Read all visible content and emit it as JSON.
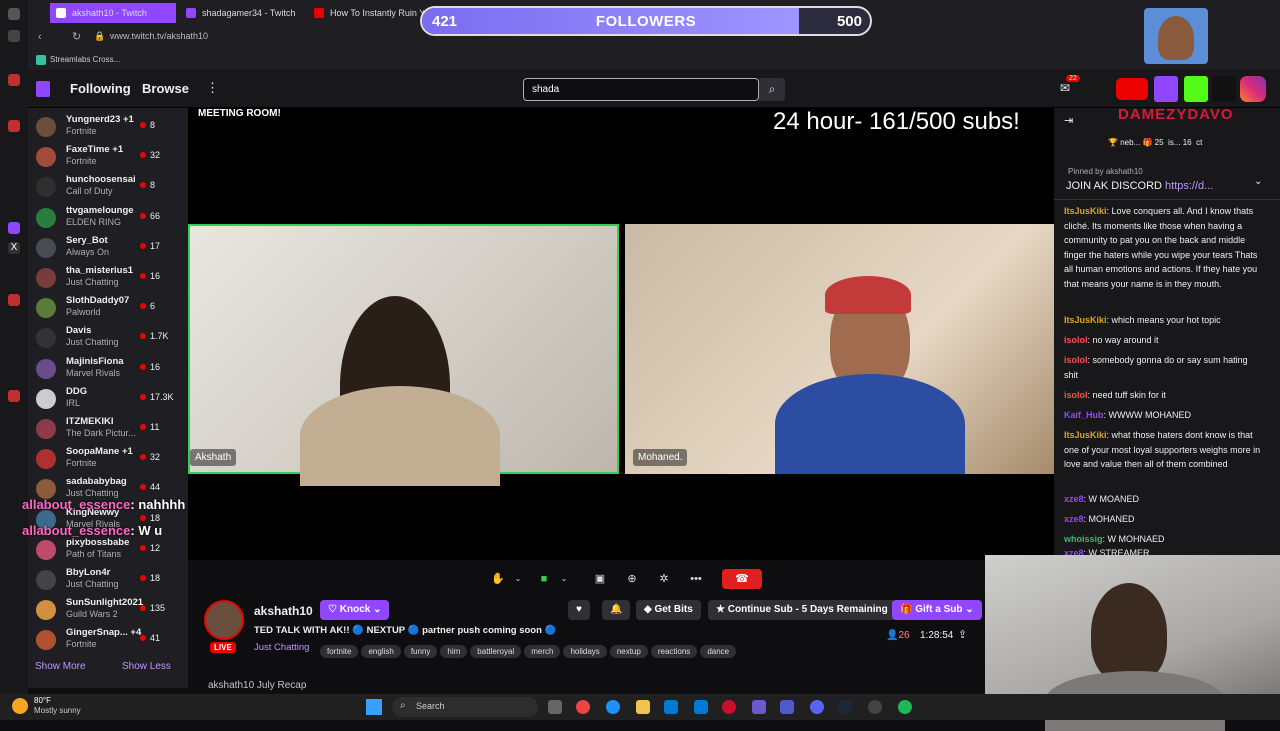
{
  "browser": {
    "tabs": [
      {
        "title": "akshath10 - Twitch",
        "active": true
      },
      {
        "title": "shadagamer34 - Twitch",
        "active": false
      },
      {
        "title": "How To Instantly Ruin Yo",
        "active": false
      }
    ],
    "url": "www.twitch.tv/akshath10",
    "bookmark": "Streamlabs Cross..."
  },
  "followers": {
    "label": "FOLLOWERS",
    "current": "421",
    "goal": "500",
    "progress": 0.842
  },
  "nav": {
    "following": "Following",
    "browse": "Browse",
    "search_value": "shada",
    "notif_badge": "22"
  },
  "sidebar": {
    "channels": [
      {
        "name": "Yungnerd23 +1",
        "game": "Fortnite",
        "viewers": "8",
        "color": "#6b4f3a"
      },
      {
        "name": "FaxeTime +1",
        "game": "Fortnite",
        "viewers": "32",
        "color": "#a34b3b"
      },
      {
        "name": "hunchoosensai",
        "game": "Call of Duty",
        "viewers": "8",
        "color": "#2f2f2f"
      },
      {
        "name": "ttvgamelounge",
        "game": "ELDEN RING",
        "viewers": "66",
        "color": "#2a7d3e"
      },
      {
        "name": "Sery_Bot",
        "game": "Always On",
        "viewers": "17",
        "color": "#4a4a55"
      },
      {
        "name": "tha_misterius1",
        "game": "Just Chatting",
        "viewers": "16",
        "color": "#7a3b3b"
      },
      {
        "name": "SlothDaddy07",
        "game": "Palworld",
        "viewers": "6",
        "color": "#5b7b3a"
      },
      {
        "name": "Davis",
        "game": "Just Chatting",
        "viewers": "1.7K",
        "color": "#333"
      },
      {
        "name": "MajinisFiona",
        "game": "Marvel Rivals",
        "viewers": "16",
        "color": "#6a4c8c"
      },
      {
        "name": "DDG",
        "game": "IRL",
        "viewers": "17.3K",
        "color": "#ccc"
      },
      {
        "name": "ITZMEKIKI",
        "game": "The Dark Pictur...",
        "viewers": "11",
        "color": "#8c3b4c"
      },
      {
        "name": "SoopaMane +1",
        "game": "Fortnite",
        "viewers": "32",
        "color": "#b03030"
      },
      {
        "name": "sadababybag",
        "game": "Just Chatting",
        "viewers": "44",
        "color": "#8c5a3c"
      },
      {
        "name": "KingNewwy",
        "game": "Marvel Rivals",
        "viewers": "18",
        "color": "#3c6a8c"
      },
      {
        "name": "pixybossbabe",
        "game": "Path of Titans",
        "viewers": "12",
        "color": "#c04a6a"
      },
      {
        "name": "BbyLon4r",
        "game": "Just Chatting",
        "viewers": "18",
        "color": "#444"
      },
      {
        "name": "SunSunlight2021",
        "game": "Guild Wars 2",
        "viewers": "135",
        "color": "#d09040"
      },
      {
        "name": "GingerSnap... +4",
        "game": "Fortnite",
        "viewers": "41",
        "color": "#b05030"
      }
    ],
    "show_more": "Show More",
    "show_less": "Show Less"
  },
  "stream_overlay": {
    "meeting": "MEETING ROOM!",
    "subs": "24 hour- 161/500 subs!",
    "participant1": "Akshath",
    "participant2": "Mohaned.",
    "overlay_chat": [
      {
        "user": "allabout_essence",
        "text": ": nahhhh"
      },
      {
        "user": "allabout_essence",
        "text": ": W u"
      }
    ]
  },
  "channel": {
    "name": "akshath10",
    "live": "LIVE",
    "knock": "Knock",
    "get_bits": "Get Bits",
    "continue_sub": "Continue Sub - 5 Days Remaining",
    "gift_sub": "Gift a Sub",
    "title": "TED TALK WITH AK!! 🔵 NEXTUP 🔵 partner push coming soon 🔵",
    "category": "Just Chatting",
    "tags": [
      "fortnite",
      "english",
      "funny",
      "him",
      "battleroyal",
      "merch",
      "holidays",
      "nextup",
      "reactions",
      "dance"
    ],
    "viewers": "26",
    "uptime": "1:28:54",
    "recap": "akshath10 July Recap"
  },
  "chat": {
    "top_gifters": [
      {
        "name": "neb...",
        "count": "25"
      },
      {
        "name": "is...",
        "count": "16"
      },
      {
        "name": "ct",
        "count": ""
      }
    ],
    "pinned_by": "Pinned by",
    "pinned_user": "akshath10",
    "pinned_text": "JOIN AK DISCORD",
    "pinned_link": "https://d...",
    "messages": [
      {
        "user": "ItsJusKiki",
        "cls": "u-gold",
        "text": ": Love conquers all. And I know thats cliché. Its moments like those when having a community to pat you on the back and middle finger the haters while you wipe your tears Thats all human emotions and actions. If they hate you that means your name is in they mouth."
      },
      {
        "user": "ItsJusKiki",
        "cls": "u-gold",
        "text": ": which means your hot topic"
      },
      {
        "user": "isolol",
        "cls": "u-pink",
        "text": ": no way around it"
      },
      {
        "user": "isolol",
        "cls": "u-pink",
        "text": ": somebody gonna do or say sum hating shit"
      },
      {
        "user": "isolol",
        "cls": "u-pink",
        "text": ": need tuff skin for it"
      },
      {
        "user": "Kaif_Hub",
        "cls": "u-purple",
        "text": ": WWWW MOHANED"
      },
      {
        "user": "ItsJusKiki",
        "cls": "u-gold",
        "text": ": what those haters dont know is that one of your most loyal supporters weighs more in love and value then all of them combined"
      },
      {
        "user": "xze8",
        "cls": "u-purple",
        "text": ": W MOANED"
      },
      {
        "user": "xze8",
        "cls": "u-purple",
        "text": ": MOHANED"
      },
      {
        "user": "whoissig",
        "cls": "u-green",
        "text": ": W MOHNAED"
      },
      {
        "user": "xze8",
        "cls": "u-purple",
        "text": ": W STREAMER"
      }
    ]
  },
  "branding": {
    "handle": "DAMEZYDAVO"
  },
  "taskbar": {
    "temp": "80°F",
    "weather": "Mostly sunny",
    "search": "Search"
  }
}
